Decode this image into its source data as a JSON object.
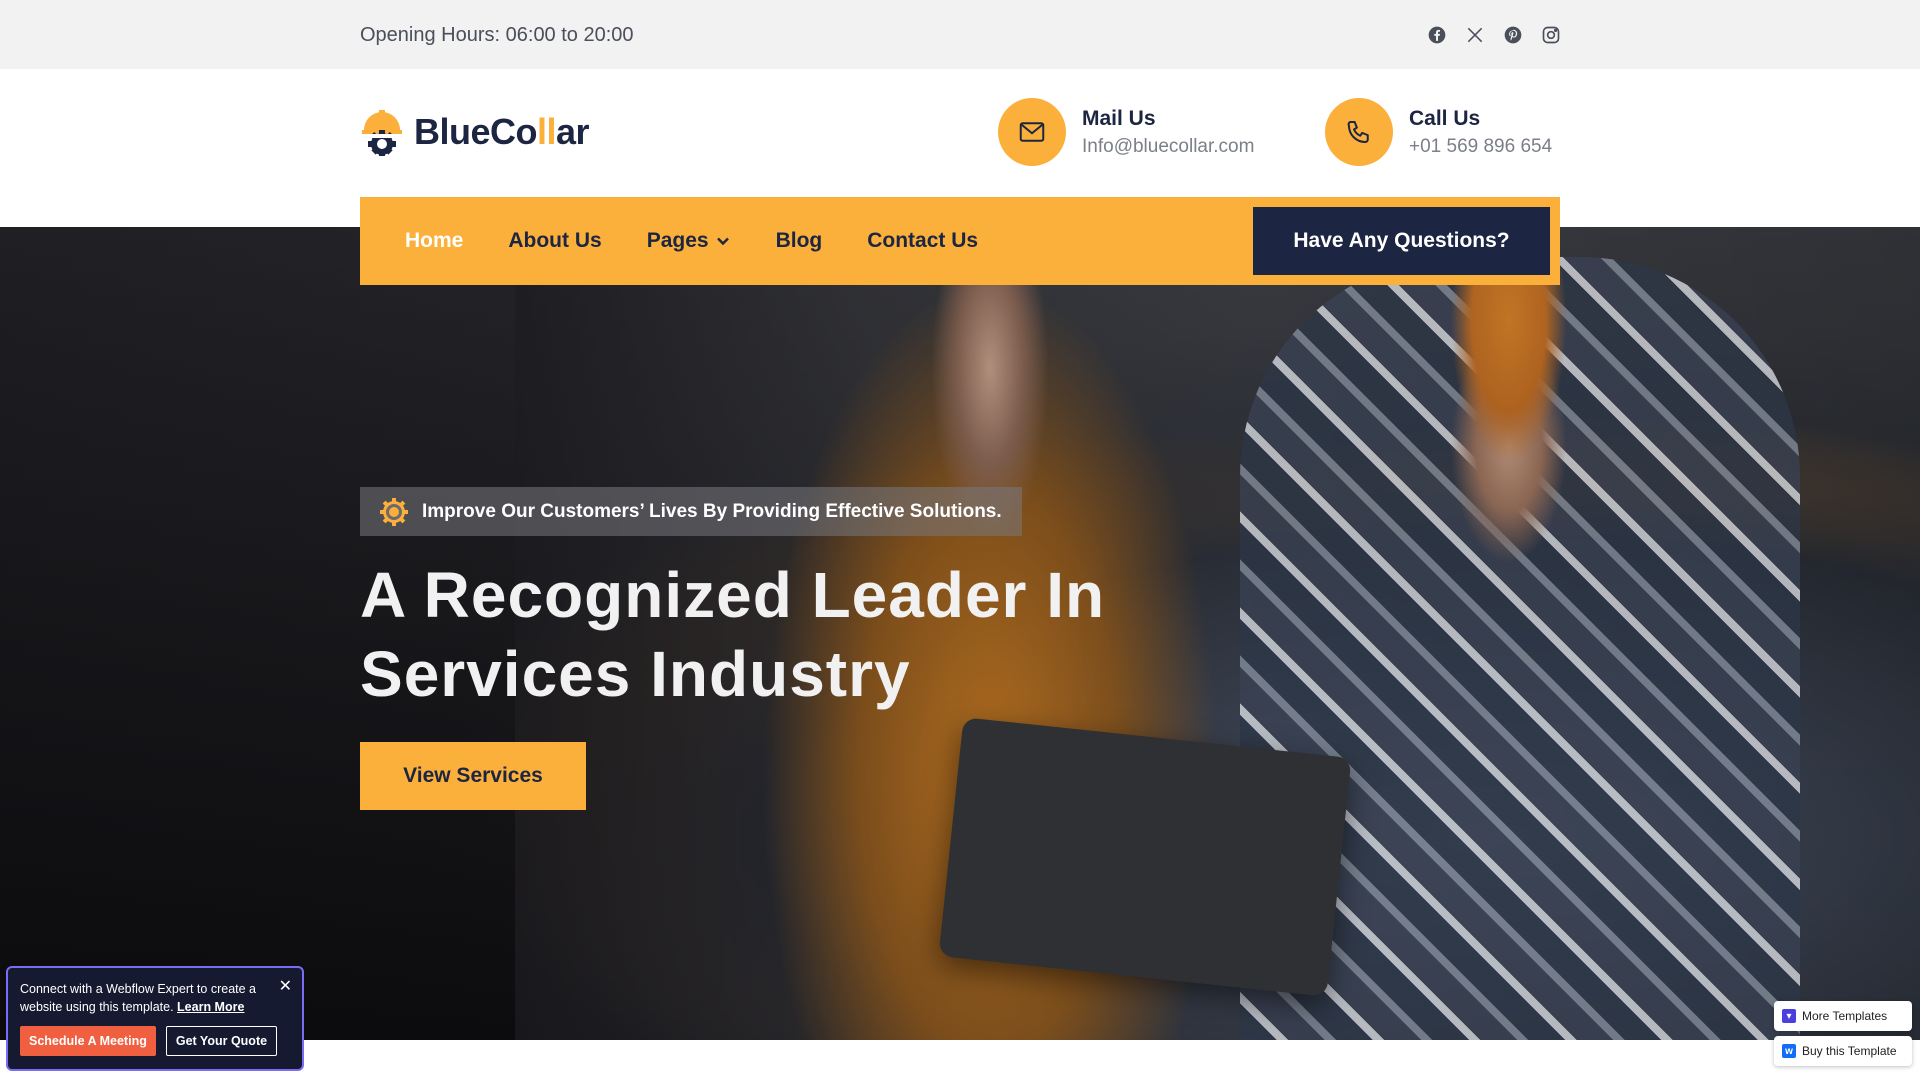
{
  "topbar": {
    "hours": "Opening Hours: 06:00 to 20:00",
    "social": [
      "facebook-icon",
      "x-icon",
      "pinterest-icon",
      "instagram-icon"
    ]
  },
  "logo": {
    "part1": "BlueCo",
    "part2": "ll",
    "part3": "ar"
  },
  "contact": {
    "mail_label": "Mail Us",
    "mail_value": "Info@bluecollar.com",
    "call_label": "Call Us",
    "call_value": "+01 569 896 654"
  },
  "nav": {
    "items": [
      "Home",
      "About Us",
      "Pages",
      "Blog",
      "Contact Us"
    ],
    "cta": "Have Any Questions?"
  },
  "hero": {
    "tagline": "Improve Our Customers’ Lives By Providing Effective Solutions.",
    "headline_line1": "A Recognized Leader In",
    "headline_line2": "Services Industry",
    "button": "View Services"
  },
  "popup": {
    "message": "Connect with a Webflow Expert to create a website using this template.",
    "learn_more": "Learn More",
    "close": "✕",
    "schedule": "Schedule A Meeting",
    "quote": "Get Your Quote"
  },
  "floating": {
    "more_templates": "More Templates",
    "buy_template": "Buy this Template"
  },
  "colors": {
    "accent": "#fbb03b",
    "navy": "#1c2541",
    "popup_button": "#f05f40"
  }
}
